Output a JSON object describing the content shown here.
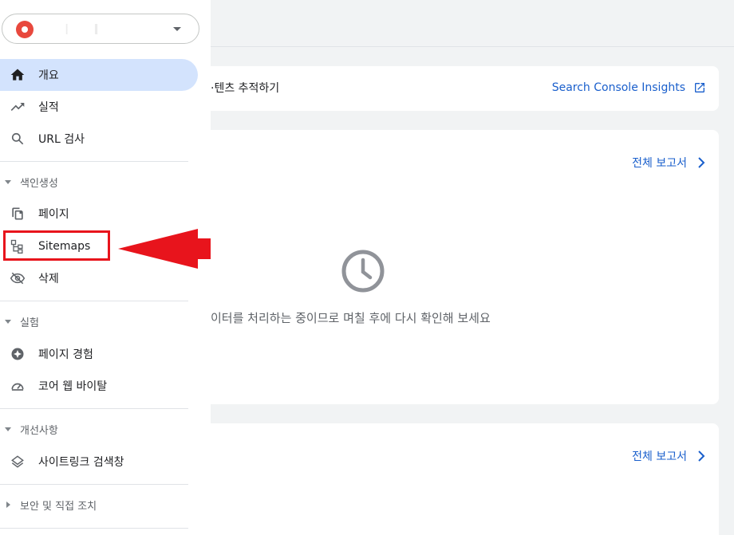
{
  "sidebar": {
    "property_selector": {
      "name": ""
    },
    "items": [
      {
        "label": "개요",
        "icon": "home-icon",
        "active": true
      },
      {
        "label": "실적",
        "icon": "trending-icon"
      },
      {
        "label": "URL 검사",
        "icon": "search-icon"
      }
    ],
    "sections": [
      {
        "label": "색인생성",
        "expanded": true,
        "items": [
          {
            "label": "페이지",
            "icon": "pages-icon"
          },
          {
            "label": "Sitemaps",
            "icon": "sitemap-icon"
          },
          {
            "label": "삭제",
            "icon": "visibility-off-icon"
          }
        ]
      },
      {
        "label": "실험",
        "expanded": true,
        "items": [
          {
            "label": "페이지 경험",
            "icon": "experience-icon"
          },
          {
            "label": "코어 웹 바이탈",
            "icon": "speed-icon"
          }
        ]
      },
      {
        "label": "개선사항",
        "expanded": true,
        "items": [
          {
            "label": "사이트링크 검색창",
            "icon": "layers-icon"
          }
        ]
      },
      {
        "label": "보안 및 직접 조치",
        "expanded": false,
        "items": []
      }
    ]
  },
  "main": {
    "insights_card": {
      "text": "·텐츠 추적하기",
      "link_label": "Search Console Insights",
      "link_icon": "open-in-new-icon"
    },
    "report_card_1": {
      "link_label": "전체 보고서",
      "status_icon": "clock-icon",
      "status_text": "이터를 처리하는 중이므로 며칠 후에 다시 확인해 보세요"
    },
    "report_card_2": {
      "link_label": "전체 보고서"
    }
  },
  "annotation": {
    "highlight_color": "#e8141c"
  },
  "colors": {
    "accent": "#1a5fcc",
    "active_bg": "#d3e3fd",
    "page_bg": "#f1f3f4"
  }
}
